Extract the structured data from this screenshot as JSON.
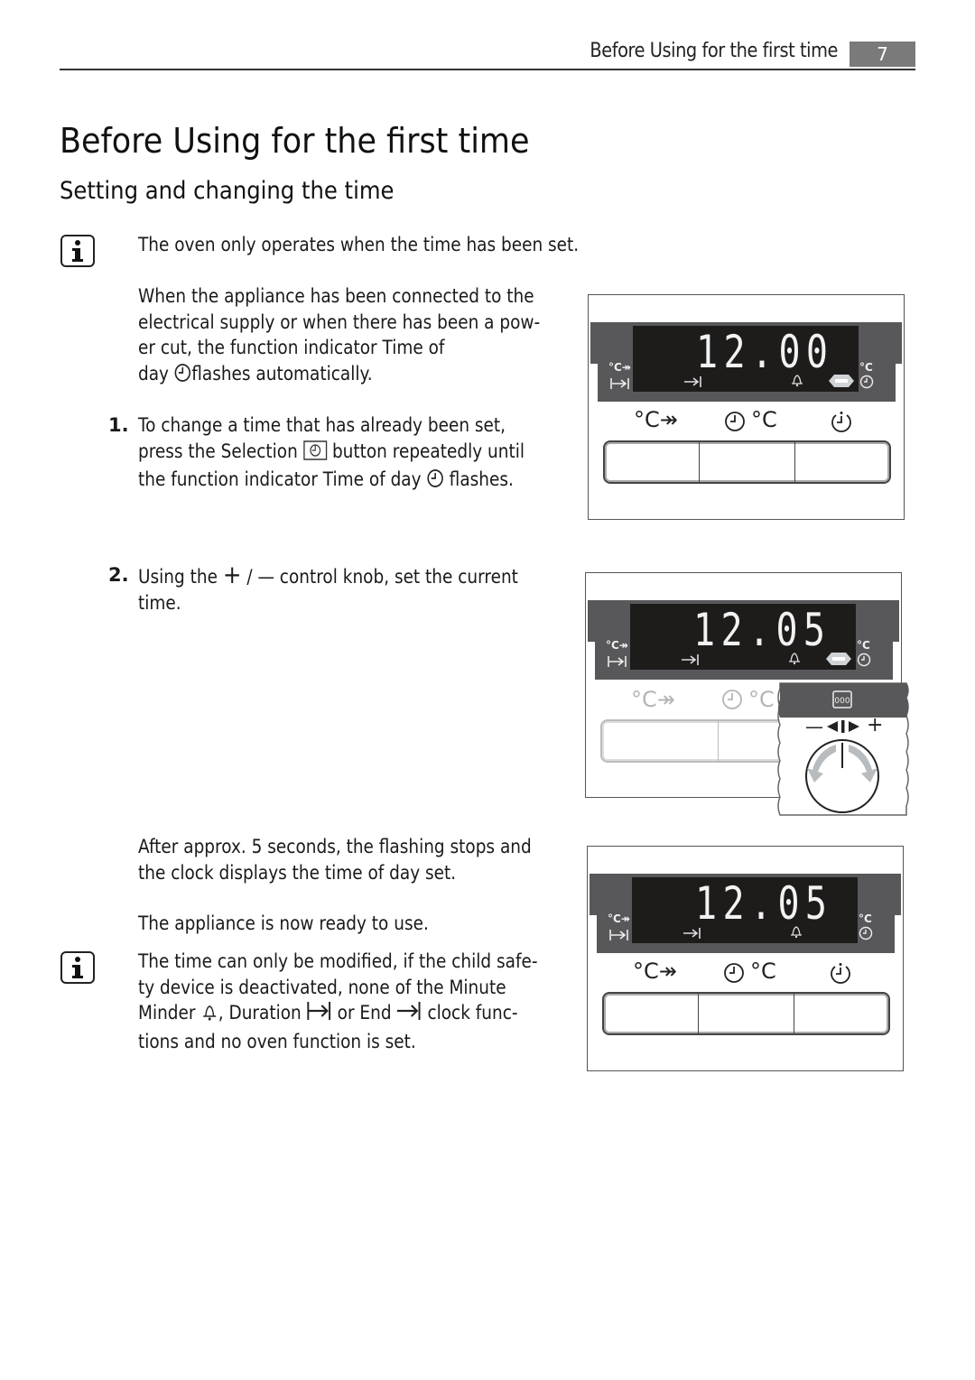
{
  "header": {
    "running_title": "Before Using for the first time",
    "page_number": "7"
  },
  "title": "Before Using for the first time",
  "subtitle": "Setting and changing the time",
  "note1": {
    "icon": "info-icon",
    "text": "The oven only operates when the time has been set."
  },
  "intro": {
    "lines": [
      "When the appliance has been connected to the",
      "electrical supply or when there has been a pow-",
      "er cut, the function indicator Time of"
    ],
    "line4_before": "day ",
    "line4_icon": "clock-icon",
    "line4_after": "flashes automatically."
  },
  "steps": [
    {
      "number": "1.",
      "line1": "To change a time that has already been set,",
      "line2_before": "press the Selection ",
      "line2_icon": "selection-button-icon",
      "line2_after": " button repeatedly until",
      "line3_before": "the function indicator Time of day ",
      "line3_icon": "clock-icon",
      "line3_after": " flashes."
    },
    {
      "number": "2.",
      "line1_before": "Using the ",
      "plus": "+",
      "slash": " / ",
      "minus": "—",
      "line1_after": " control knob, set the current",
      "line2": "time."
    }
  ],
  "after": {
    "line1": "After approx. 5 seconds, the flashing stops and",
    "line2": "the clock displays the time of day set.",
    "ready": "The appliance is now ready to use."
  },
  "note2": {
    "icon": "info-icon",
    "line1": "The time can only be modified, if the child safe-",
    "line2": "ty device is deactivated, none of the Minute",
    "line3_a": "Minder ",
    "line3_bell": "bell-icon",
    "line3_b": ", Duration ",
    "line3_duration": "duration-icon",
    "line3_c": " or End ",
    "line3_end": "end-time-icon",
    "line3_d": " clock func-",
    "line4": "tions and no oven function is set."
  },
  "panels": [
    {
      "display": "12.00",
      "left_top_label": "°C↠",
      "right_top_label": "°C",
      "indicators": [
        "duration-icon",
        "end-time-icon",
        "bell-icon",
        "flashing-indicator",
        "clock-icon"
      ],
      "flashing": true,
      "buttons": [
        "°C↠",
        "°C",
        ""
      ],
      "button_symbols": [
        "fast-heat-icon",
        "clock-temp-icon",
        "selection-icon"
      ]
    },
    {
      "display": "12.05",
      "left_top_label": "°C↠",
      "right_top_label": "°C",
      "flashing": true,
      "knob": {
        "minus": "—",
        "plus": "+",
        "icon": "display-000-icon"
      }
    },
    {
      "display": "12.05",
      "left_top_label": "°C↠",
      "right_top_label": "°C",
      "flashing": false
    }
  ],
  "symbols": {
    "fast_heat": "°C",
    "temp": "°C",
    "small_c": "°C"
  }
}
